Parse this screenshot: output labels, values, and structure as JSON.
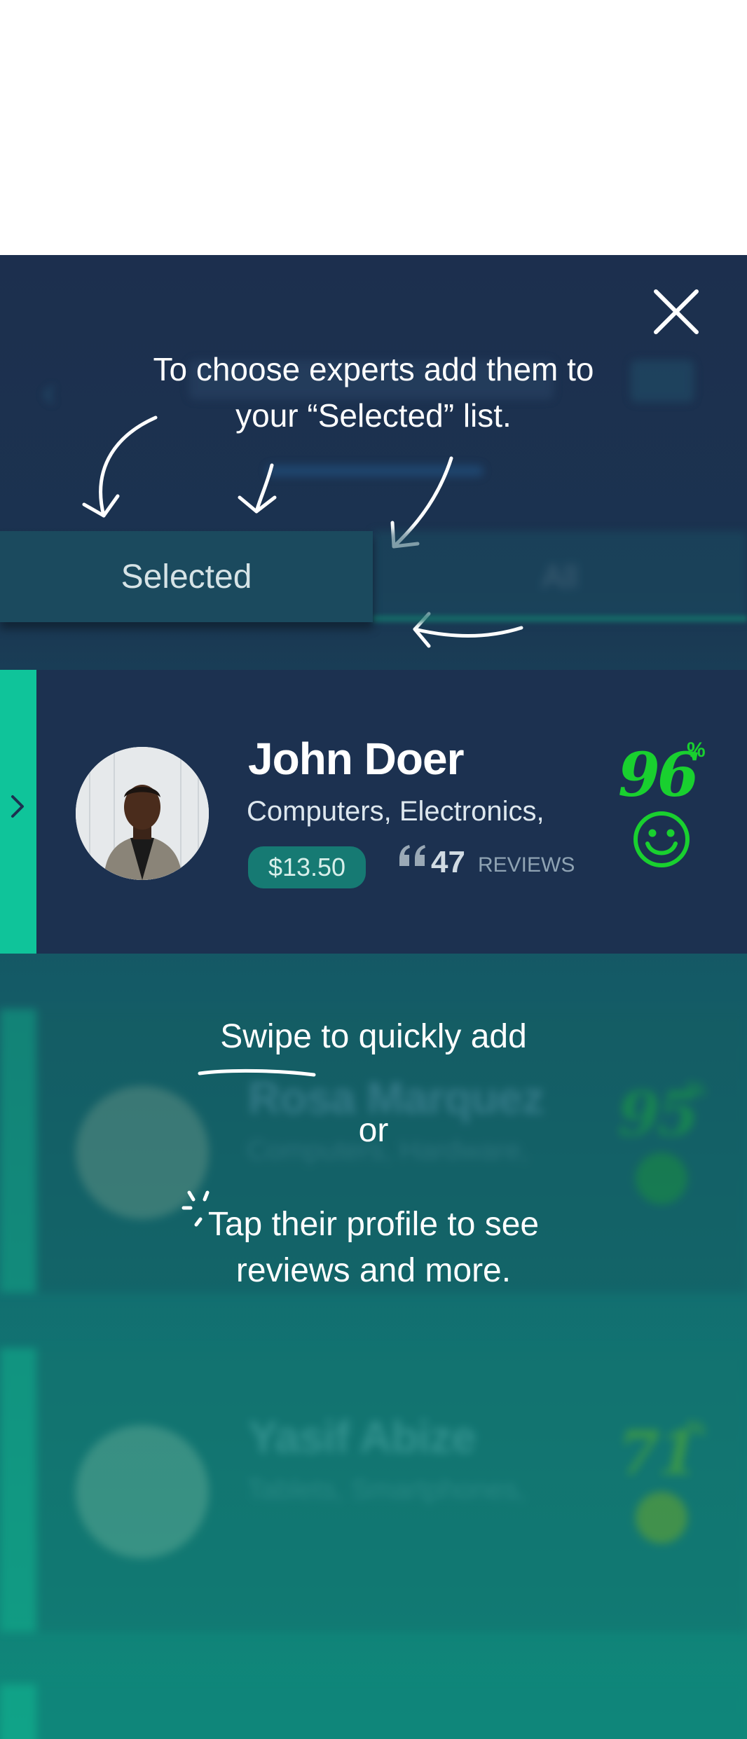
{
  "overlay": {
    "instruction_line1": "To choose experts add them to",
    "instruction_line2": "your “Selected” list.",
    "swipe_hint_word": "Swipe",
    "swipe_hint_rest": "to quickly add",
    "or_text": "or",
    "tap_hint_line1": "Tap their profile to see",
    "tap_hint_line2": "reviews and more."
  },
  "tabs": {
    "selected_label": "Selected",
    "all_label": "All"
  },
  "experts": [
    {
      "name": "John Doer",
      "categories": "Computers, Electronics,",
      "price": "$13.50",
      "reviews": "47",
      "reviews_label": "REVIEWS",
      "rating": "96",
      "rating_unit": "%",
      "mood_icon": "smiley-icon"
    },
    {
      "name": "Rosa Marquez",
      "categories": "Computers, Hardware,",
      "rating": "95",
      "rating_unit": "%",
      "mood_icon": "smiley-icon"
    },
    {
      "name": "Yasif Abize",
      "categories": "Tablets, Smartphones,",
      "rating": "71",
      "rating_unit": "%",
      "mood_icon": "smiley-icon"
    }
  ],
  "colors": {
    "overlay_top": "#1c2f4e",
    "overlay_bottom": "#0f8a7b",
    "swipe_accent": "#0fc49a",
    "rating_green": "#19d02f",
    "price_badge": "#167a73"
  }
}
